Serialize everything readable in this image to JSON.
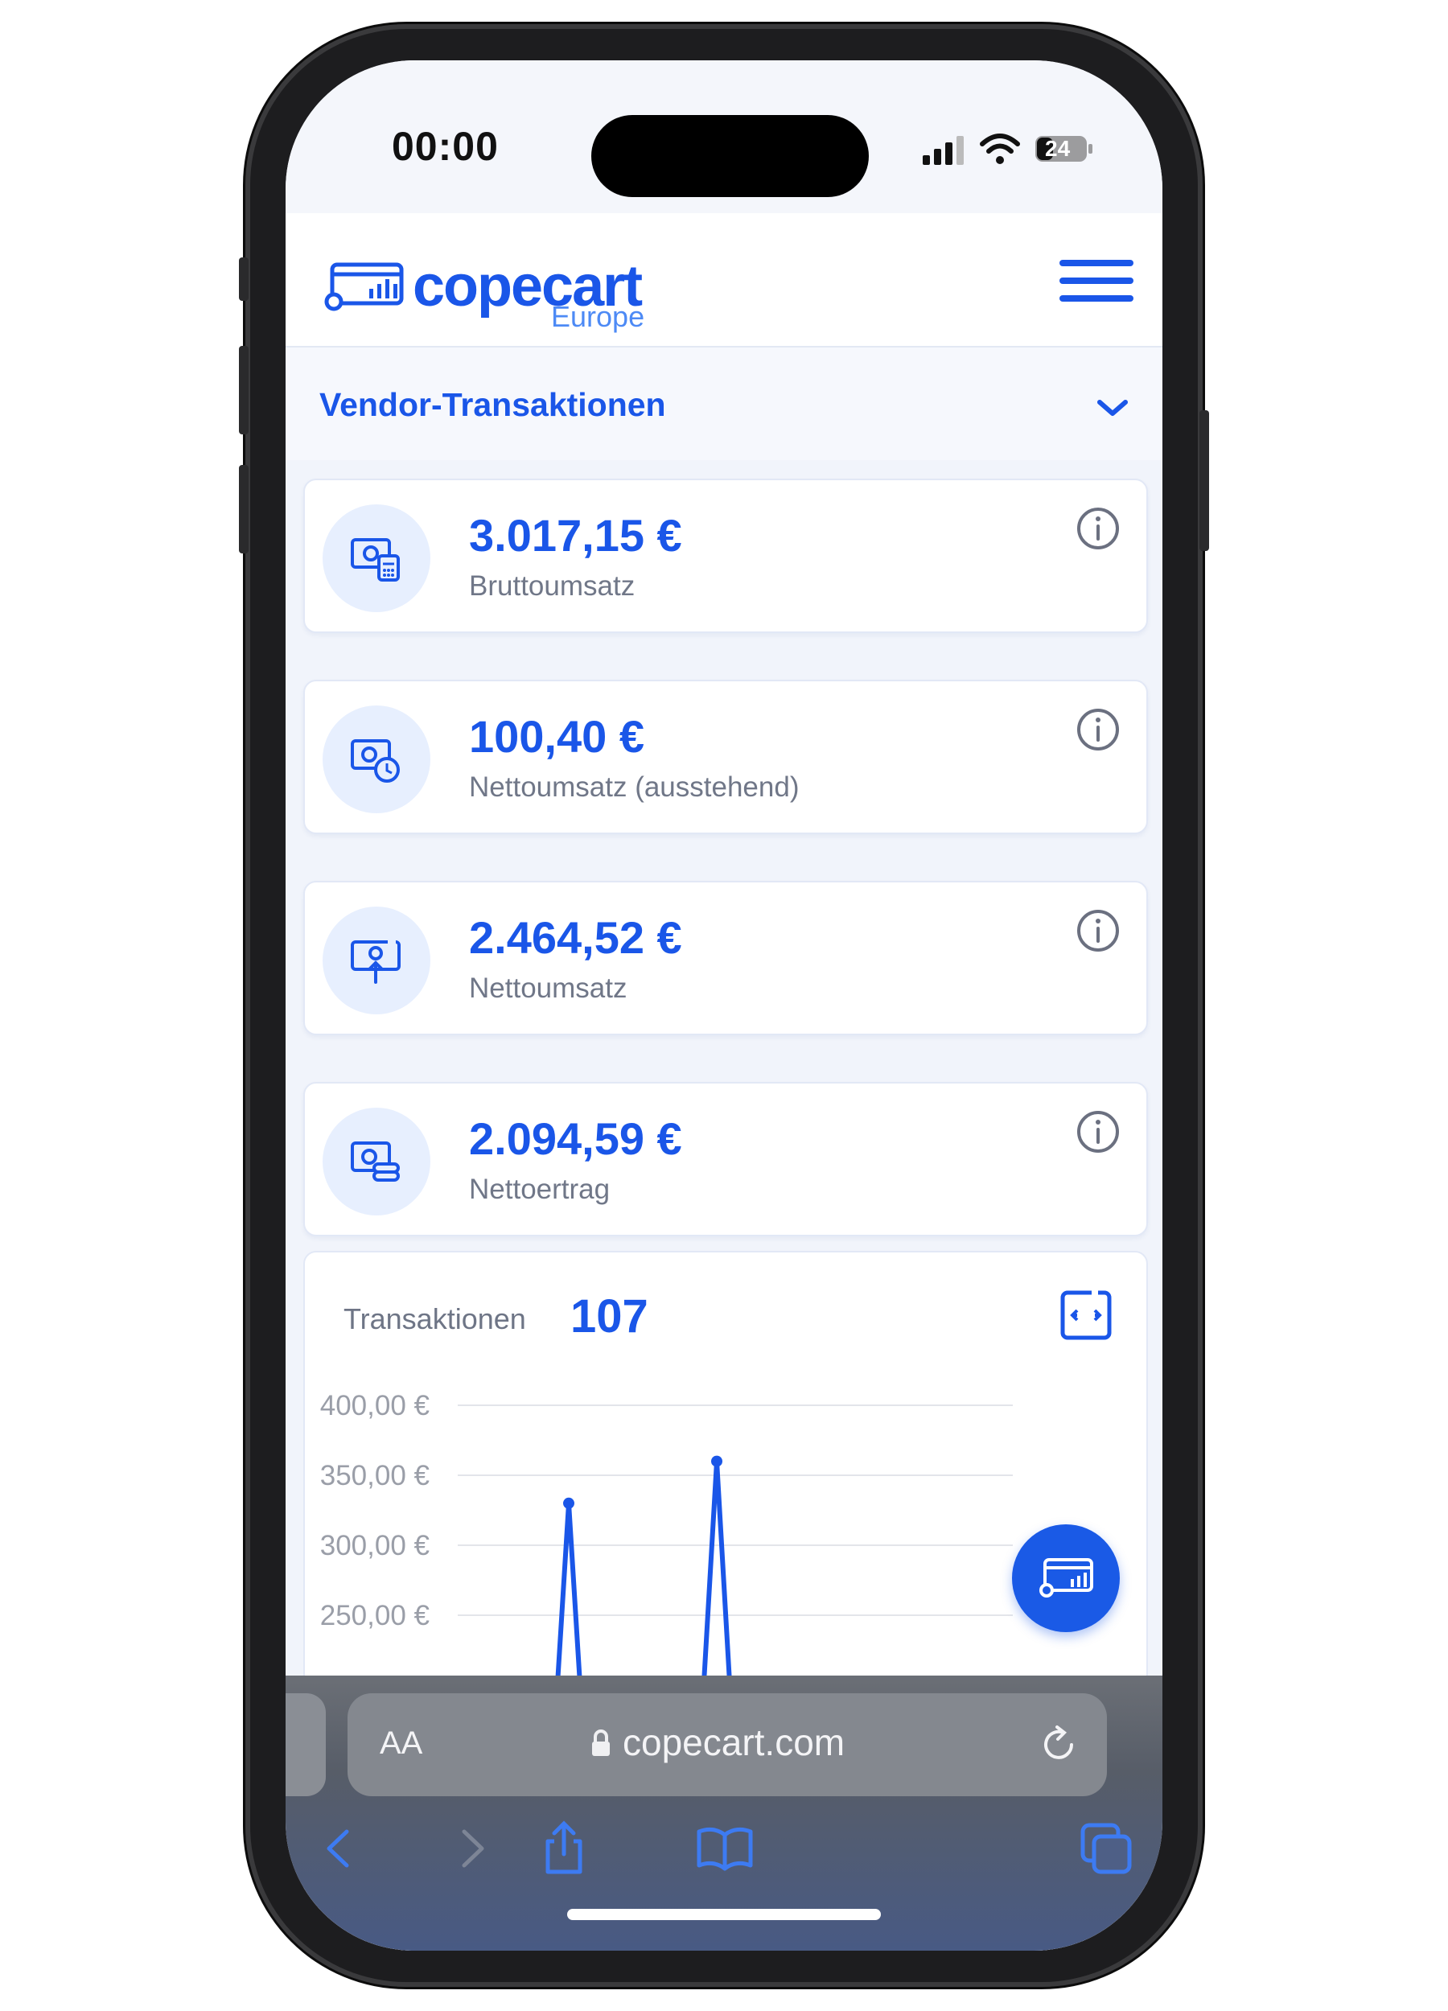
{
  "status_bar": {
    "time": "00:00",
    "battery": "24"
  },
  "header": {
    "logo_text": "copecart",
    "logo_sub": "Europe"
  },
  "section": {
    "title": "Vendor-Transaktionen"
  },
  "stats": [
    {
      "amount": "3.017,15 €",
      "label": "Bruttoumsatz",
      "icon": "cash-calculator-icon"
    },
    {
      "amount": "100,40 €",
      "label": "Nettoumsatz (ausstehend)",
      "icon": "cash-clock-icon"
    },
    {
      "amount": "2.464,52 €",
      "label": "Nettoumsatz",
      "icon": "cash-upload-icon"
    },
    {
      "amount": "2.094,59 €",
      "label": "Nettoertrag",
      "icon": "cash-coins-icon"
    }
  ],
  "transactions": {
    "label": "Transaktionen",
    "count": "107"
  },
  "chart_data": {
    "type": "line",
    "title": "",
    "xlabel": "",
    "ylabel": "",
    "y_ticks": [
      "400,00 €",
      "350,00 €",
      "300,00 €",
      "250,00 €"
    ],
    "ylim": [
      250,
      400
    ],
    "grid": true,
    "series": [
      {
        "values": [
          0,
          0,
          0,
          330,
          0,
          0,
          0,
          360,
          0,
          0,
          0,
          0,
          0,
          0,
          0,
          0
        ]
      }
    ],
    "color": "#1a56e8"
  },
  "browser": {
    "text_size": "AA",
    "url": "copecart.com"
  },
  "colors": {
    "accent": "#1a56e8",
    "card_bg": "#ffffff",
    "page_bg": "#f1f4fb",
    "icon_bg": "#e7effe"
  }
}
